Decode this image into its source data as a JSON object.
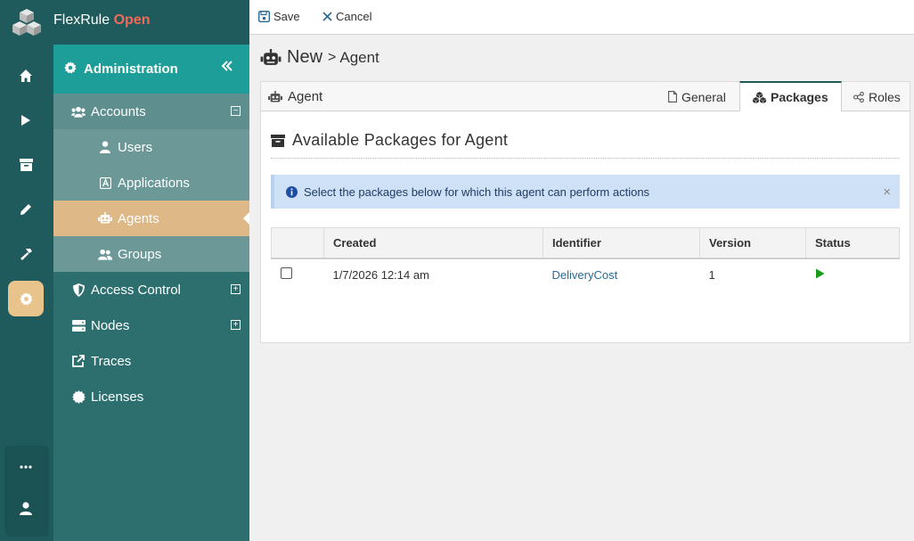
{
  "brand": {
    "name": "FlexRule",
    "edition": "Open"
  },
  "rail": {
    "items": [
      {
        "icon": "home-icon"
      },
      {
        "icon": "play-icon"
      },
      {
        "icon": "archive-icon"
      },
      {
        "icon": "pencil-icon"
      },
      {
        "icon": "hammer-icon"
      },
      {
        "icon": "gear-icon",
        "active": true
      }
    ],
    "bottom": [
      {
        "icon": "more-icon"
      },
      {
        "icon": "user-icon"
      }
    ]
  },
  "nav": {
    "header": "Administration",
    "items": {
      "accounts": "Accounts",
      "users": "Users",
      "applications": "Applications",
      "agents": "Agents",
      "groups": "Groups",
      "access_control": "Access Control",
      "nodes": "Nodes",
      "traces": "Traces",
      "licenses": "Licenses"
    },
    "expander_minus": "−",
    "expander_plus": "+"
  },
  "toolbar": {
    "save_label": "Save",
    "cancel_label": "Cancel"
  },
  "breadcrumb": {
    "new_label": "New",
    "separator": ">",
    "entity": "Agent"
  },
  "card": {
    "title": "Agent",
    "tabs": {
      "general": "General",
      "packages": "Packages",
      "roles": "Roles"
    },
    "section_title": "Available Packages for Agent",
    "alert": "Select the packages below for which this agent can perform actions",
    "alert_close": "×",
    "table": {
      "headers": {
        "created": "Created",
        "identifier": "Identifier",
        "version": "Version",
        "status": "Status"
      },
      "rows": [
        {
          "created": "1/7/2026 12:14 am",
          "identifier": "DeliveryCost",
          "version": "1",
          "status": "running"
        }
      ]
    }
  },
  "colors": {
    "rail_bg": "#1f5b5c",
    "nav_header": "#1d9e98",
    "selected": "#deb887",
    "brand_open": "#f26a5a",
    "status_green": "#1a9a1a"
  }
}
